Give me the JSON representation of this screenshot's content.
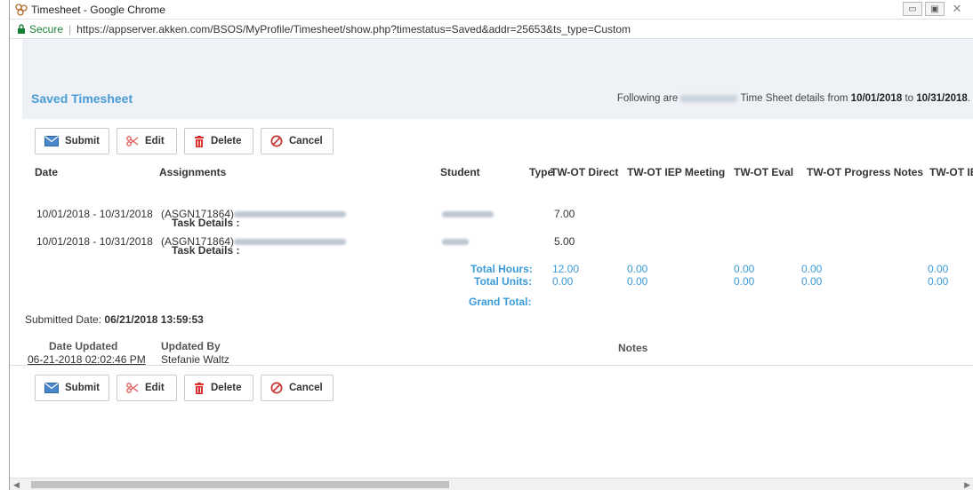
{
  "window": {
    "title": "Timesheet - Google Chrome",
    "minimize": "▭",
    "maximize": "▣",
    "close": "✕"
  },
  "address": {
    "secure": "Secure",
    "url": "https://appserver.akken.com/BSOS/MyProfile/Timesheet/show.php?timestatus=Saved&addr=25653&ts_type=Custom"
  },
  "header": {
    "title": "Saved Timesheet",
    "info_prefix": "Following are",
    "info_middle": "Time Sheet details from",
    "date_from": "10/01/2018",
    "to": "to",
    "date_to": "10/31/2018",
    "period_end": "."
  },
  "buttons": {
    "submit": "Submit",
    "edit": "Edit",
    "delete": "Delete",
    "cancel": "Cancel"
  },
  "table": {
    "columns": [
      "Date",
      "Assignments",
      "Student",
      "Type",
      "TW-OT Direct",
      "TW-OT IEP Meeting",
      "TW-OT Eval",
      "TW-OT Progress Notes",
      "TW-OT IE"
    ],
    "rows": [
      {
        "date": "10/01/2018 - 10/31/2018",
        "assignment_id": "(ASGN171864)",
        "task_details": "Task Details :",
        "direct": "7.00"
      },
      {
        "date": "10/01/2018 - 10/31/2018",
        "assignment_id": "(ASGN171864)",
        "task_details": "Task Details :",
        "direct": "5.00"
      }
    ],
    "totals": {
      "hours_label": "Total Hours:",
      "units_label": "Total Units:",
      "grand_label": "Grand Total:",
      "hours": [
        "12.00",
        "0.00",
        "0.00",
        "0.00",
        "0.00"
      ],
      "units": [
        "0.00",
        "0.00",
        "0.00",
        "0.00",
        "0.00"
      ]
    }
  },
  "submitted": {
    "label": "Submitted Date:",
    "value": "06/21/2018 13:59:53"
  },
  "history": {
    "col_date": "Date Updated",
    "col_by": "Updated By",
    "col_notes": "Notes",
    "date": "06-21-2018 02:02:46 PM",
    "by": "Stefanie Waltz"
  },
  "colors": {
    "accent_blue": "#3a9bd9",
    "title_blue": "#4a9bd6",
    "delete_red": "#d9302c",
    "edit_red": "#e05a5a",
    "secure_green": "#188038"
  }
}
